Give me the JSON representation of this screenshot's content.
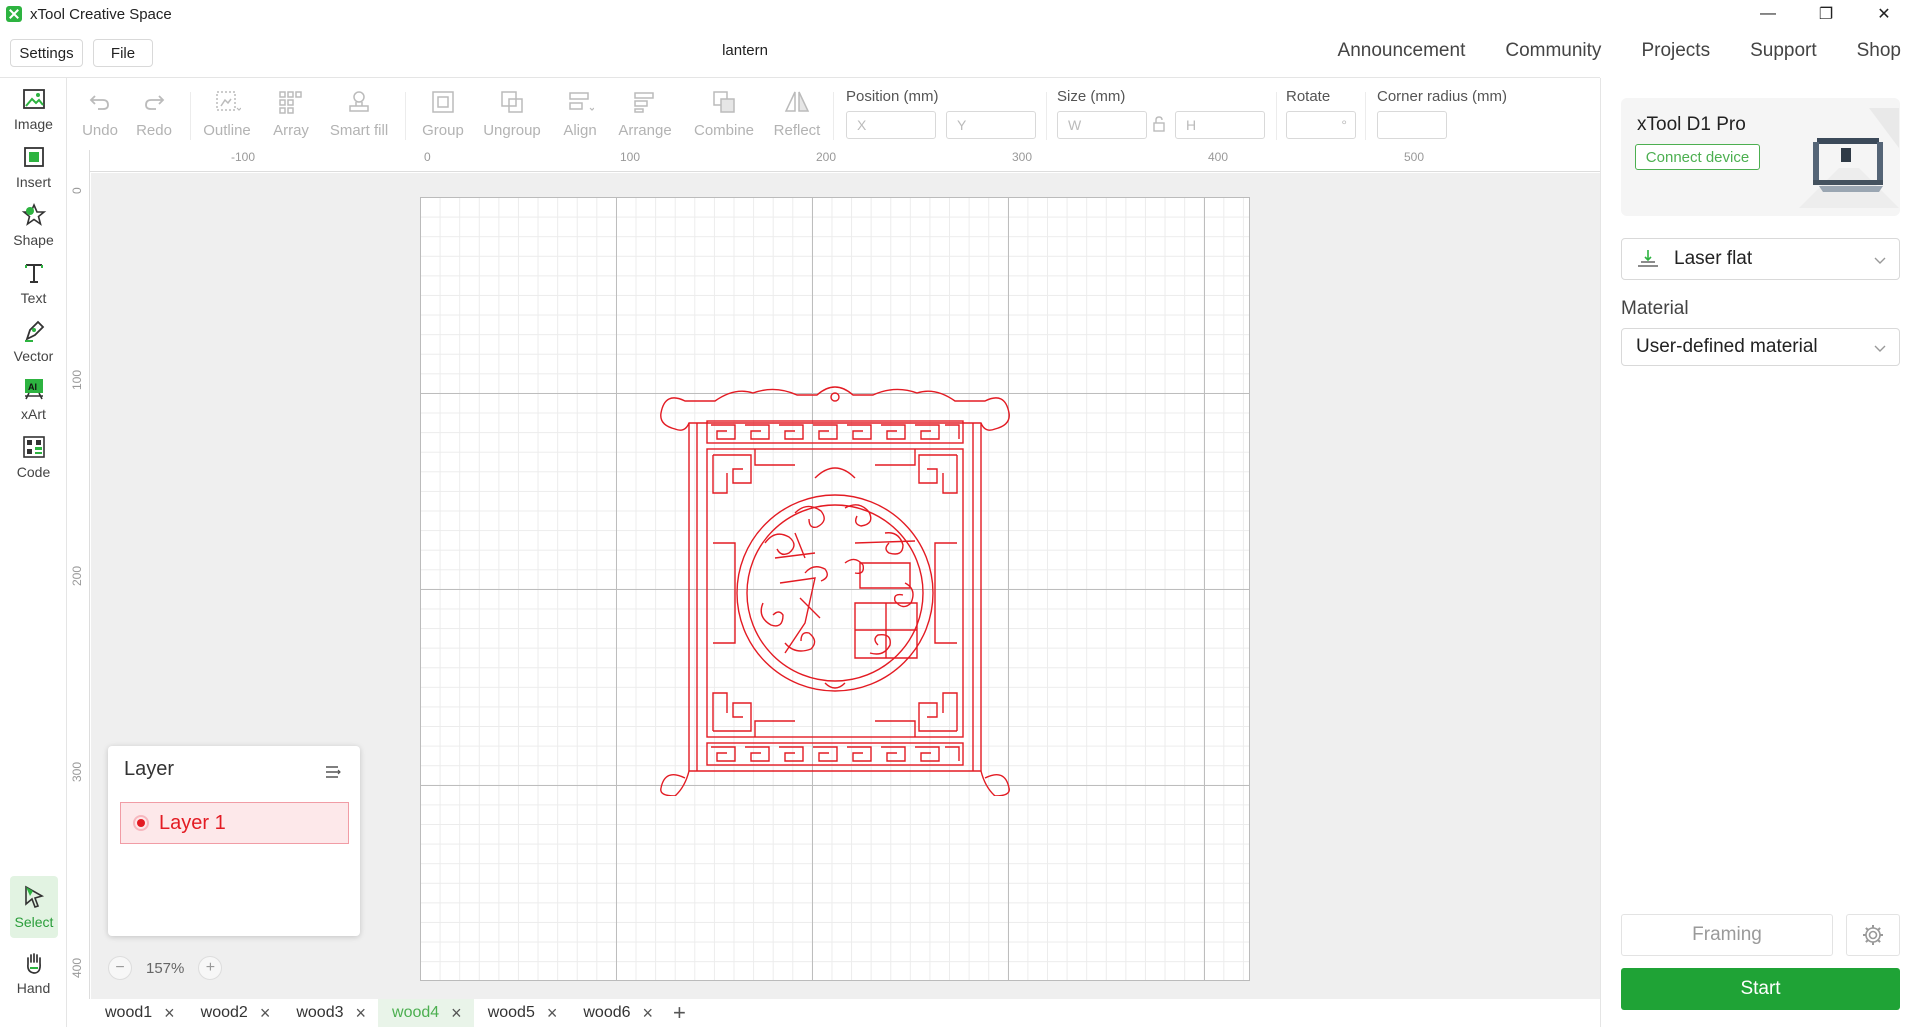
{
  "app": {
    "title": "xTool Creative Space",
    "doc_name": "lantern"
  },
  "window_controls": {
    "minimize": "—",
    "restore": "❐",
    "close": "✕"
  },
  "menu": {
    "settings": "Settings",
    "file": "File"
  },
  "topnav": [
    "Announcement",
    "Community",
    "Projects",
    "Support",
    "Shop"
  ],
  "left_tools": [
    {
      "label": "Image",
      "icon": "image-icon"
    },
    {
      "label": "Insert",
      "icon": "insert-icon"
    },
    {
      "label": "Shape",
      "icon": "shape-icon"
    },
    {
      "label": "Text",
      "icon": "text-icon"
    },
    {
      "label": "Vector",
      "icon": "vector-icon"
    },
    {
      "label": "xArt",
      "icon": "xart-icon"
    },
    {
      "label": "Code",
      "icon": "code-icon"
    },
    {
      "label": "Select",
      "icon": "select-icon",
      "active": true
    },
    {
      "label": "Hand",
      "icon": "hand-icon"
    }
  ],
  "top_tools": {
    "undo": "Undo",
    "redo": "Redo",
    "outline": "Outline",
    "array": "Array",
    "smart_fill": "Smart fill",
    "group": "Group",
    "ungroup": "Ungroup",
    "align": "Align",
    "arrange": "Arrange",
    "combine": "Combine",
    "reflect": "Reflect"
  },
  "fields": {
    "position_label": "Position (mm)",
    "x_placeholder": "X",
    "y_placeholder": "Y",
    "size_label": "Size (mm)",
    "w_placeholder": "W",
    "h_placeholder": "H",
    "rotate_label": "Rotate",
    "rotate_unit": "°",
    "corner_label": "Corner radius (mm)"
  },
  "ruler": {
    "top": [
      "-100",
      "0",
      "100",
      "200",
      "300",
      "400",
      "500"
    ],
    "left": [
      "0",
      "100",
      "200",
      "300",
      "400"
    ]
  },
  "layer_panel": {
    "title": "Layer",
    "layer_name": "Layer 1",
    "layer_color": "#e31b23"
  },
  "zoom": {
    "minus": "−",
    "value": "157%",
    "plus": "+"
  },
  "tabs": [
    {
      "name": "wood1"
    },
    {
      "name": "wood2"
    },
    {
      "name": "wood3"
    },
    {
      "name": "wood4",
      "active": true
    },
    {
      "name": "wood5"
    },
    {
      "name": "wood6"
    }
  ],
  "tab_close": "×",
  "tab_add": "+",
  "device": {
    "name": "xTool D1 Pro",
    "connect": "Connect device"
  },
  "mode": {
    "value": "Laser flat"
  },
  "material": {
    "label": "Material",
    "value": "User-defined material"
  },
  "actions": {
    "framing": "Framing",
    "start": "Start"
  },
  "colors": {
    "accent": "#1fa336",
    "design_stroke": "#e31b23"
  }
}
